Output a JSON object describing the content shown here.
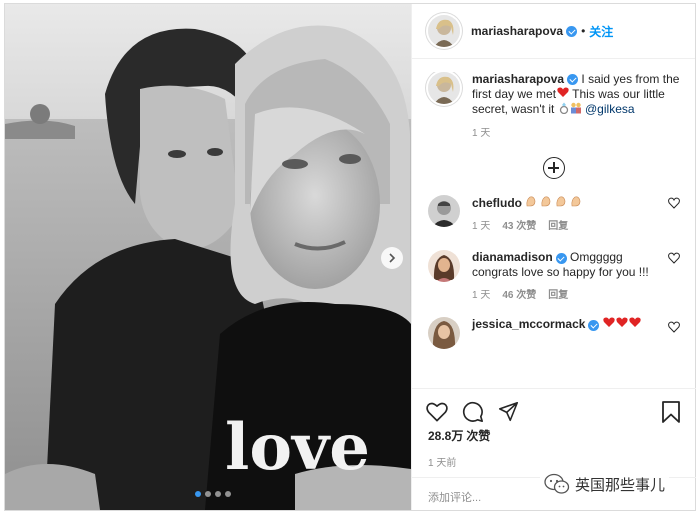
{
  "post": {
    "author": "mariasharapova",
    "follow_label": "关注",
    "separator": "•",
    "caption": "I said yes from the first day we met",
    "caption_cont": " This was our little secret, wasn't it ",
    "mention": "@gilkesa",
    "caption_time": "1 天",
    "shirt_text": "love"
  },
  "comments": [
    {
      "user": "chefludo",
      "verified": false,
      "text": "",
      "time": "1 天",
      "likes": "43 次赞",
      "reply": "回复"
    },
    {
      "user": "dianamadison",
      "verified": true,
      "text": "Omggggg congrats love so happy for you !!!",
      "time": "1 天",
      "likes": "46 次赞",
      "reply": "回复"
    },
    {
      "user": "jessica_mccormack",
      "verified": true,
      "text": "",
      "time": "",
      "likes": "",
      "reply": ""
    }
  ],
  "actions": {
    "likes_count": "28.8万",
    "likes_label": "次赞",
    "posted_ago": "1 天前",
    "comment_placeholder": "添加评论..."
  },
  "watermark": {
    "text": "英国那些事儿"
  },
  "colors": {
    "accent": "#0095f6",
    "verified": "#3897f0",
    "heart": "#ed4956"
  },
  "icons": [
    "heart-icon",
    "comment-icon",
    "share-icon",
    "bookmark-icon",
    "plus-circle-icon",
    "chevron-right-icon"
  ]
}
